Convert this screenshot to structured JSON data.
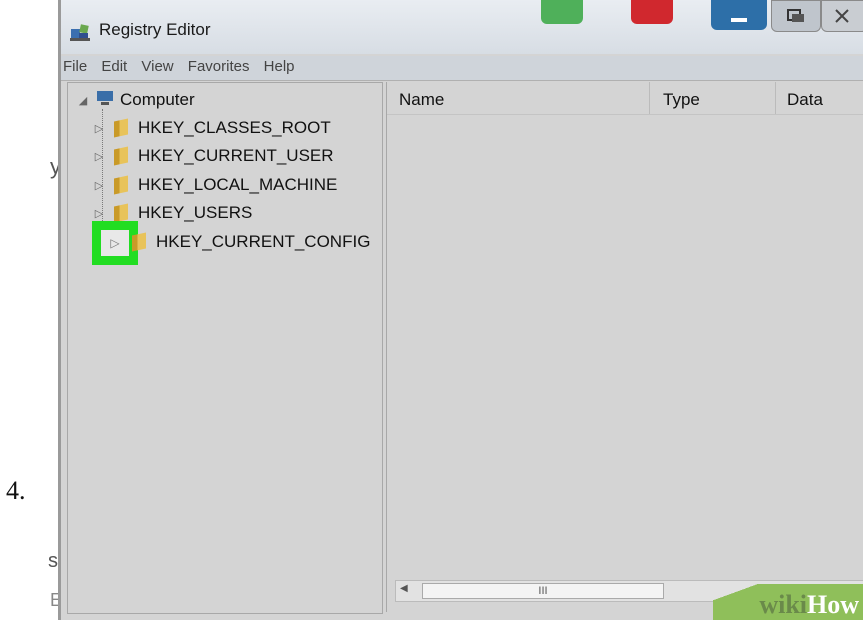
{
  "step_number": "4.",
  "background_fragments": [
    "y",
    "s",
    "E"
  ],
  "window": {
    "title": "Registry Editor",
    "title_icon": "registry-icon",
    "caption_buttons": [
      "minimize",
      "restore",
      "close"
    ],
    "accent_colors": {
      "green_button": "#4fb05a",
      "red_button": "#d0282e",
      "blue_button": "#2d6fa8",
      "highlight": "#22dd22"
    }
  },
  "menu": {
    "items": [
      "File",
      "Edit",
      "View",
      "Favorites",
      "Help"
    ]
  },
  "tree": {
    "root": "Computer",
    "root_icon": "computer-icon",
    "children": [
      {
        "label": "HKEY_CLASSES_ROOT"
      },
      {
        "label": "HKEY_CURRENT_USER"
      },
      {
        "label": "HKEY_LOCAL_MACHINE"
      },
      {
        "label": "HKEY_USERS"
      },
      {
        "label": "HKEY_CURRENT_CONFIG"
      }
    ]
  },
  "list": {
    "columns": [
      "Name",
      "Type",
      "Data"
    ]
  },
  "scrollbar": {
    "thumb_grip": "III"
  },
  "watermark": {
    "part1": "wiki",
    "part2": "How"
  }
}
